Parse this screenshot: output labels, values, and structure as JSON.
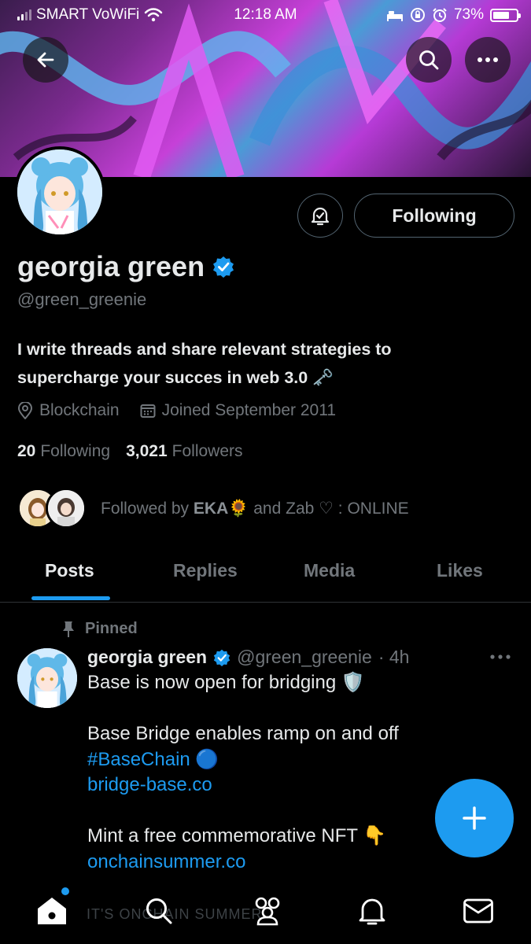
{
  "status_bar": {
    "carrier": "SMART VoWiFi",
    "time": "12:18 AM",
    "battery": "73%",
    "battery_level": 0.73
  },
  "header": {
    "back_icon": "back-arrow-icon",
    "search_icon": "search-icon",
    "more_icon": "more-icon"
  },
  "profile": {
    "name": "georgia green",
    "handle": "@green_greenie",
    "bio_line1": "I write threads and share relevant strategies to",
    "bio_line2": "supercharge your succes in web 3.0 🗝️",
    "location": "Blockchain",
    "joined": "Joined September 2011",
    "following_count": "20",
    "following_label": "Following",
    "followers_count": "3,021",
    "followers_label": "Followers",
    "followed_by_prefix": "Followed by",
    "followed_by_name": "EKA🌻",
    "followed_by_suffix": "and Zab ♡ : ONLINE",
    "follow_button": "Following",
    "verified_color": "#1d9bf0"
  },
  "tabs": [
    {
      "label": "Posts",
      "active": true
    },
    {
      "label": "Replies",
      "active": false
    },
    {
      "label": "Media",
      "active": false
    },
    {
      "label": "Likes",
      "active": false
    }
  ],
  "tweet": {
    "pinned_label": "Pinned",
    "name": "georgia green",
    "handle": "@green_greenie",
    "time": "· 4h",
    "line1": "Base is now open for bridging 🛡️",
    "line2": "Base Bridge enables ramp on and off",
    "hashtag": "#BaseChain 🔵",
    "link1": "bridge-base.co",
    "line3": "Mint a free commemorative NFT 👇",
    "link2": "onchainsummer.co"
  },
  "bottom_nav": {
    "ghost_text": "IT'S ONCHAIN SUMMER",
    "items": [
      "home-icon",
      "search-icon",
      "communities-icon",
      "notifications-icon",
      "messages-icon"
    ]
  },
  "accent": "#1d9bf0"
}
